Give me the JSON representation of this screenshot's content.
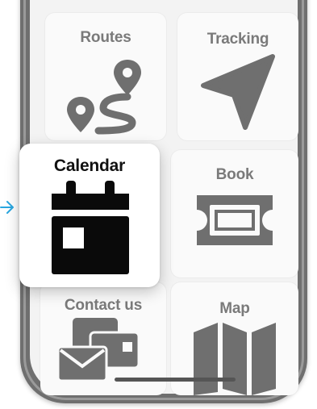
{
  "tiles": {
    "routes": {
      "label": "Routes",
      "icon": "route-icon"
    },
    "tracking": {
      "label": "Tracking",
      "icon": "navigation-arrow-icon"
    },
    "calendar": {
      "label": "Calendar",
      "icon": "calendar-icon",
      "selected": true
    },
    "book": {
      "label": "Book",
      "icon": "ticket-icon"
    },
    "contact": {
      "label": "Contact us",
      "icon": "contact-icon"
    },
    "map": {
      "label": "Map",
      "icon": "map-icon"
    }
  },
  "pointer": {
    "icon": "arrow-right-icon",
    "color": "#2aa7e0"
  },
  "colors": {
    "tile_label": "#7a7a7a",
    "icon_gray": "#6f6f6f",
    "selected_label": "#111111",
    "selected_icon": "#0a0a0a"
  }
}
